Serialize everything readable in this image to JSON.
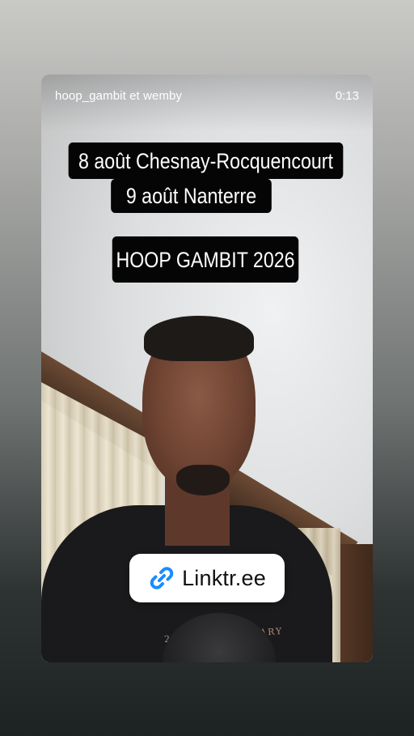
{
  "header": {
    "username": "hoop_gambit et wemby",
    "elapsed_time": "0:13"
  },
  "captions": {
    "line1": "8 août Chesnay-Rocquencourt",
    "line2": "9 août Nanterre",
    "line3": "HOOP GAMBIT 2026"
  },
  "link_sticker": {
    "label": "Linktr.ee",
    "icon": "link-icon"
  },
  "shirt_print": "20th ANNIVERSARY"
}
